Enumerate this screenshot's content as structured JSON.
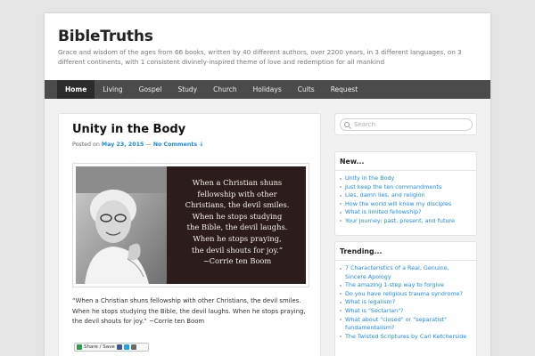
{
  "site": {
    "title": "BibleTruths",
    "description": "Grace and wisdom of the ages from 66 books, written by 40 different authors, over 2200 years, in 3 different languages, on 3 different continents, with 1 consistent divinely-inspired theme of love and redemption for all mankind"
  },
  "menu": [
    {
      "label": "Home",
      "active": true
    },
    {
      "label": "Living"
    },
    {
      "label": "Gospel"
    },
    {
      "label": "Study"
    },
    {
      "label": "Church"
    },
    {
      "label": "Holidays"
    },
    {
      "label": "Cults"
    },
    {
      "label": "Request"
    }
  ],
  "post": {
    "title": "Unity in the Body",
    "meta_prefix": "Posted on ",
    "date": "May 23, 2015",
    "meta_sep": " — ",
    "comments": "No Comments ↓",
    "quote_lines": [
      "When a Christian shuns",
      "fellowship with other",
      "Christians, the devil smiles.",
      "When he stops studying",
      "the Bible, the devil laughs.",
      "When he stops praying,",
      "the devil shouts for joy.”",
      "~Corrie ten Boom"
    ],
    "body": "“When a Christian shuns fellowship with other Christians, the devil smiles. When he stops studying the Bible, the devil laughs. When he stops praying, the devil shouts for joy.” ~Corrie ten Boom",
    "share_label": "Share / Save"
  },
  "search": {
    "placeholder": "Search"
  },
  "widgets": {
    "new": {
      "title": "New...",
      "items": [
        "Unity in the Body",
        "Just keep the ten commandments",
        "Lies, damn lies, and religion",
        "How the world will know my disciples",
        "What is limited fellowship?",
        "Your journey: past, present, and future"
      ]
    },
    "trending": {
      "title": "Trending...",
      "items": [
        "7 Characteristics of a Real, Genuine, Sincere Apology",
        "The amazing 1-step way to forgive",
        "Do you have religious trauma syndrome?",
        "What is legalism?",
        "What is \"Sectarian\"?",
        "What about \"closed\" or \"separatist\" fundamentalism?",
        "The Twisted Scriptures by Carl Ketcherside"
      ]
    }
  },
  "colors": {
    "link": "#1b8be0",
    "menu_bg": "#4b4b4b",
    "menu_active": "#2c2c2c",
    "quote_bg": "#2c1d1c"
  }
}
